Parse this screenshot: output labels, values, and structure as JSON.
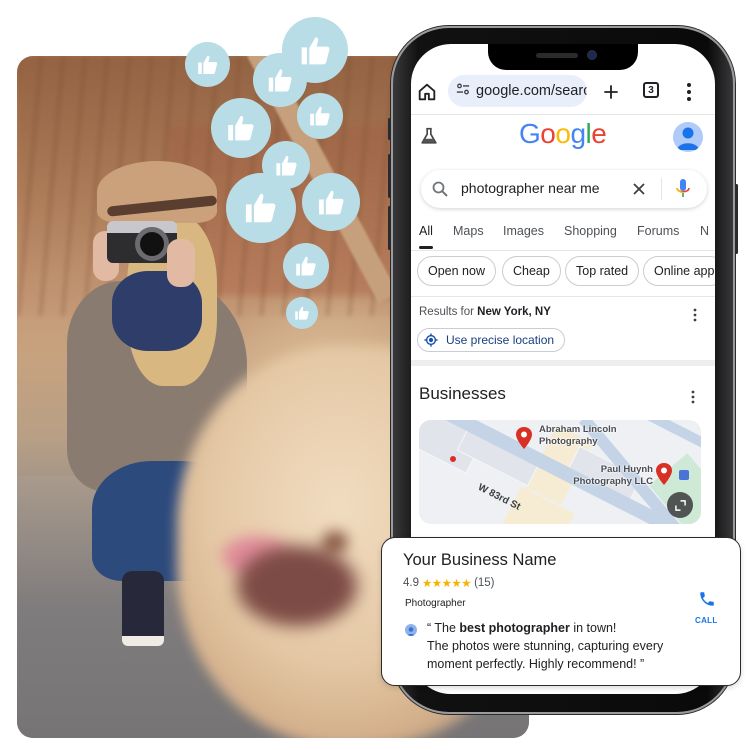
{
  "browser": {
    "url": "google.com/search",
    "url_display": "google.com/searc",
    "tab_count": "3"
  },
  "google": {
    "logo_letters": [
      {
        "char": "G",
        "color": "#4285F4"
      },
      {
        "char": "o",
        "color": "#EA4335"
      },
      {
        "char": "o",
        "color": "#FBBC05"
      },
      {
        "char": "g",
        "color": "#4285F4"
      },
      {
        "char": "l",
        "color": "#34A853"
      },
      {
        "char": "e",
        "color": "#EA4335"
      }
    ]
  },
  "search": {
    "query": "photographer near me"
  },
  "search_tabs": [
    {
      "label": "All",
      "active": true
    },
    {
      "label": "Maps"
    },
    {
      "label": "Images"
    },
    {
      "label": "Shopping"
    },
    {
      "label": "Forums"
    },
    {
      "label": "N"
    }
  ],
  "chips": [
    "Open now",
    "Cheap",
    "Top rated",
    "Online app"
  ],
  "location": {
    "prefix": "Results for ",
    "place": "New York, NY",
    "precise_button": "Use precise location"
  },
  "businesses": {
    "title": "Businesses",
    "map": {
      "pins": [
        {
          "label_line1": "Abraham Lincoln",
          "label_line2": "Photography"
        },
        {
          "label_line1": "Paul Huynh",
          "label_line2": "Photography LLC"
        }
      ],
      "street": "W 83rd St"
    }
  },
  "card": {
    "name": "Your Business Name",
    "rating": "4.9",
    "stars": "★★★★★",
    "review_count": "(15)",
    "category": "Photographer",
    "review_open": "“ The ",
    "review_bold": "best photographer",
    "review_rest1": " in town!",
    "review_line2": "The photos were stunning, capturing every",
    "review_line3": "moment perfectly. Highly recommend! ”",
    "call_label": "CALL"
  },
  "colors": {
    "accent_blue": "#1a73e8",
    "pin_red": "#d93025",
    "star_gold": "#f6b300",
    "bubble": "#b9dde6"
  }
}
